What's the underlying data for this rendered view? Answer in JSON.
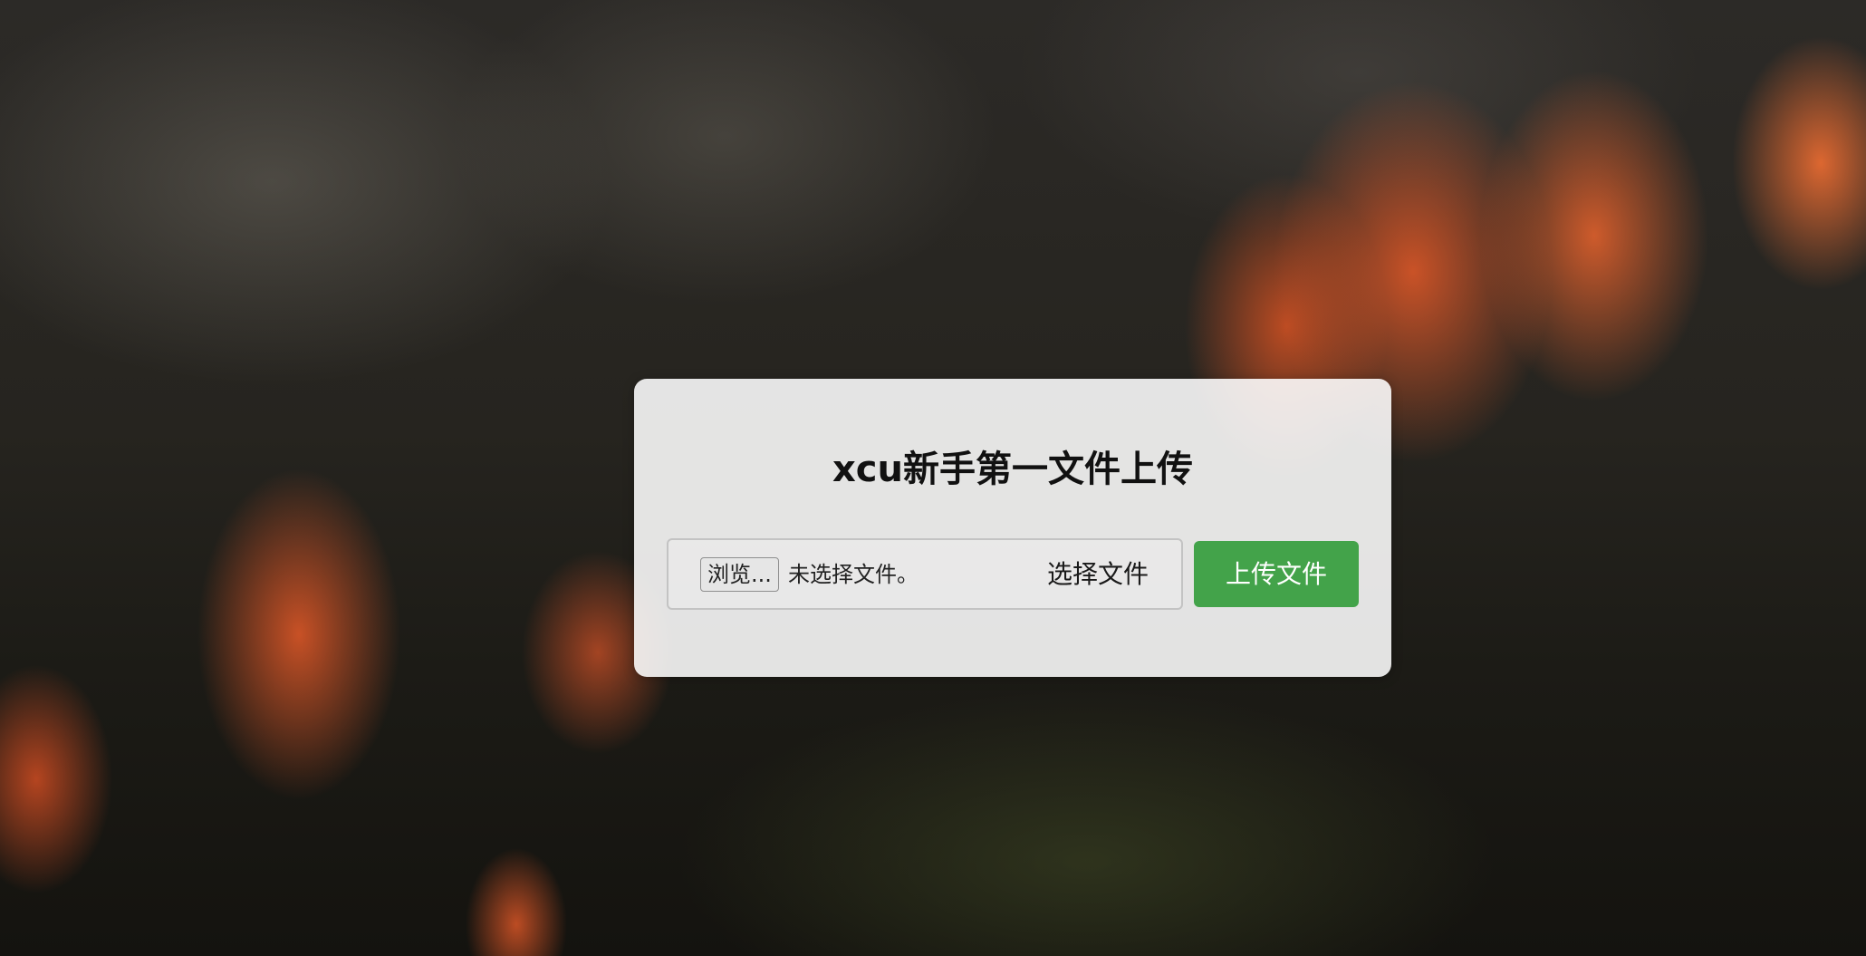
{
  "page": {
    "title": "xcu新手第一文件上传"
  },
  "upload_form": {
    "file_input": {
      "browse_label": "浏览...",
      "status_text": "未选择文件。",
      "choose_label": "选择文件"
    },
    "submit_label": "上传文件"
  },
  "colors": {
    "submit_button": "#43a34a",
    "card_background": "rgba(255,255,255,0.88)"
  },
  "background": {
    "description_icon": "forest-cliff-background"
  }
}
